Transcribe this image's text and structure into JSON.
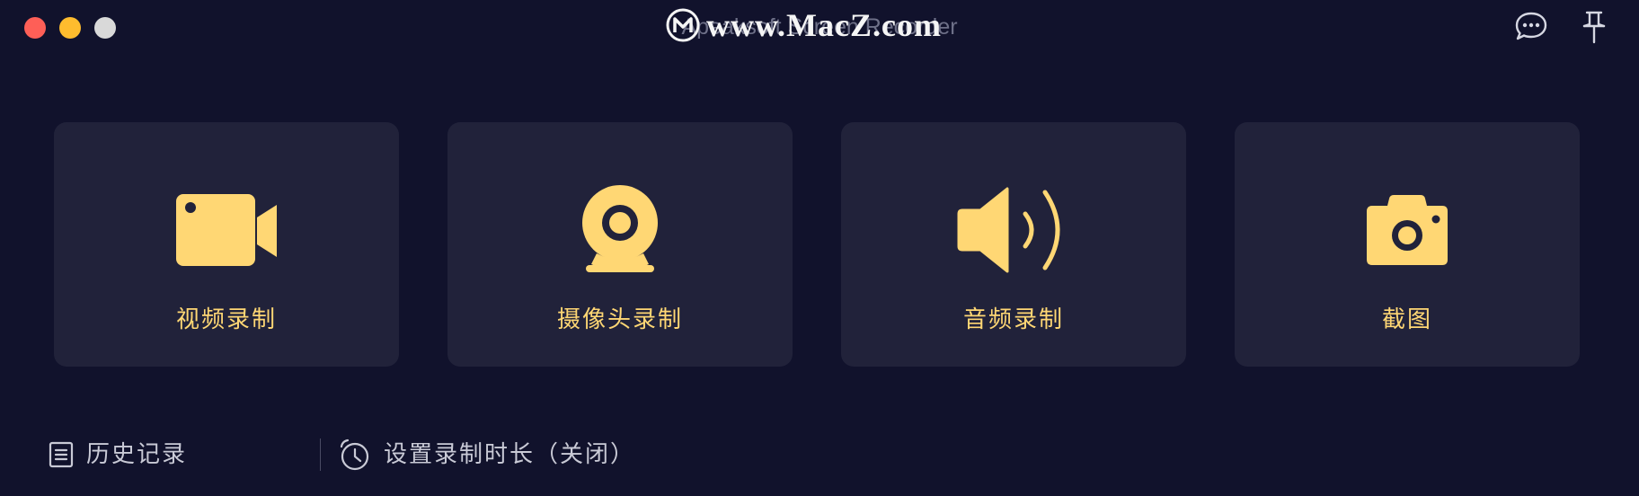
{
  "window": {
    "title": "Apeaksoft Screen Recorder",
    "watermark": "www.MacZ.com"
  },
  "title_icons": [
    {
      "icon": "chat-bubble-icon"
    },
    {
      "icon": "pin-icon"
    }
  ],
  "cards": [
    {
      "label": "视频录制",
      "icon": "video-camera-icon"
    },
    {
      "label": "摄像头录制",
      "icon": "webcam-icon"
    },
    {
      "label": "音频录制",
      "icon": "speaker-icon"
    },
    {
      "label": "截图",
      "icon": "camera-icon"
    }
  ],
  "bottom": {
    "history_label": "历史记录",
    "timer_label": "设置录制时长（关闭）"
  },
  "colors": {
    "background": "#11122c",
    "card": "#21223a",
    "accent": "#ffd774",
    "text": "#c9cad6"
  }
}
